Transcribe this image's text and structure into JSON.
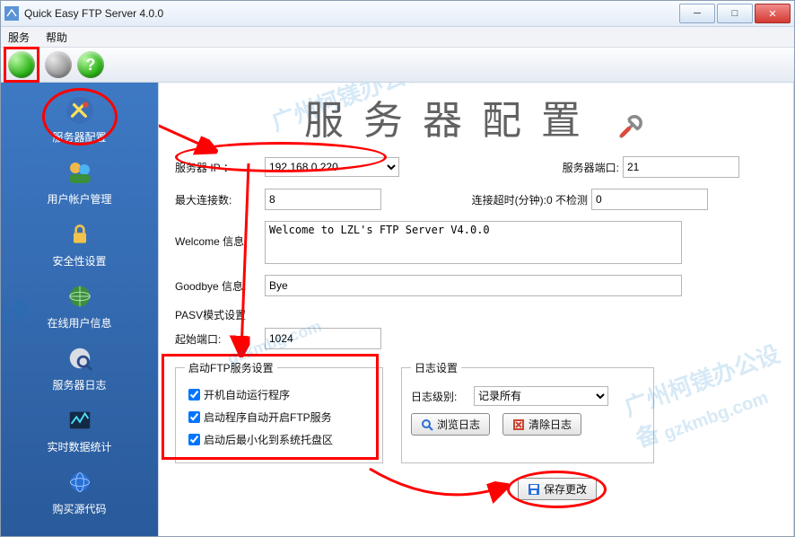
{
  "window": {
    "title": "Quick Easy FTP Server 4.0.0"
  },
  "menu": {
    "service": "服务",
    "help": "帮助"
  },
  "sidebar": {
    "items": [
      {
        "label": "服务器配置"
      },
      {
        "label": "用户帐户管理"
      },
      {
        "label": "安全性设置"
      },
      {
        "label": "在线用户信息"
      },
      {
        "label": "服务器日志"
      },
      {
        "label": "实时数据统计"
      },
      {
        "label": "购买源代码"
      }
    ]
  },
  "main": {
    "heading": "服务器配置",
    "server_ip_label": "服务器 IP ：",
    "server_ip": "192.168.0.220",
    "server_port_label": "服务器端口:",
    "server_port": "21",
    "max_conn_label": "最大连接数:",
    "max_conn": "8",
    "timeout_label": "连接超时(分钟):0 不检测",
    "timeout": "0",
    "welcome_label": "Welcome 信息:",
    "welcome": "Welcome to LZL's FTP Server V4.0.0",
    "goodbye_label": "Goodbye 信息:",
    "goodbye": "Bye",
    "pasv_label": "PASV模式设置",
    "start_port_label": "起始端口:",
    "start_port": "1024",
    "startup_legend": "启动FTP服务设置",
    "cb1": "开机自动运行程序",
    "cb2": "启动程序自动开启FTP服务",
    "cb3": "启动后最小化到系统托盘区",
    "log_legend": "日志设置",
    "log_level_label": "日志级别:",
    "log_level": "记录所有",
    "btn_browse": "浏览日志",
    "btn_clear": "清除日志",
    "btn_save": "保存更改"
  },
  "watermark": {
    "t1": "广州柯镁办公设备",
    "t2": "gzkmbg.com",
    "t3": "设备",
    "t4": "广州柯镁办公设备",
    "t5": "gzkmbg.com"
  }
}
